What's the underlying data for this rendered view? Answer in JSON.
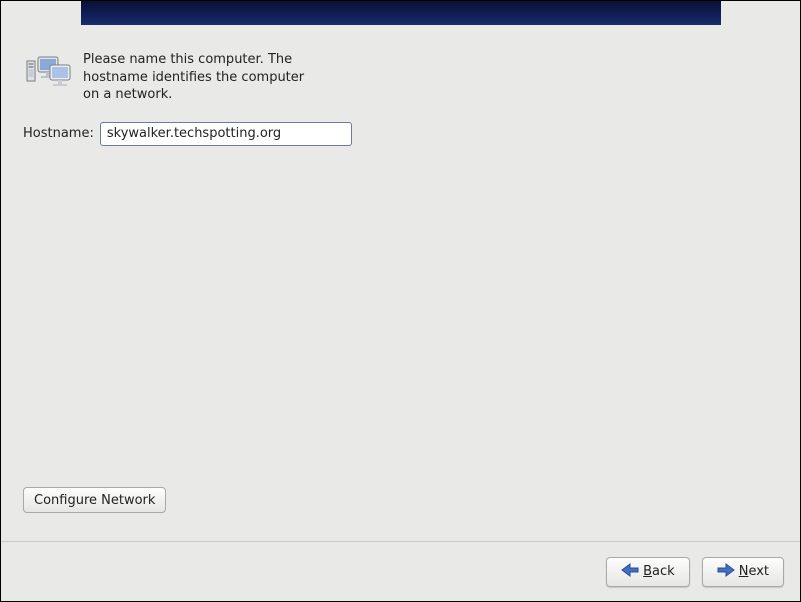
{
  "intro": {
    "text": "Please name this computer.  The hostname identifies the computer on a network."
  },
  "hostname": {
    "label": "Hostname:",
    "value": "skywalker.techspotting.org"
  },
  "buttons": {
    "configure_network": "Configure Network",
    "back_prefix": "B",
    "back_rest": "ack",
    "next_prefix": "N",
    "next_rest": "ext"
  }
}
